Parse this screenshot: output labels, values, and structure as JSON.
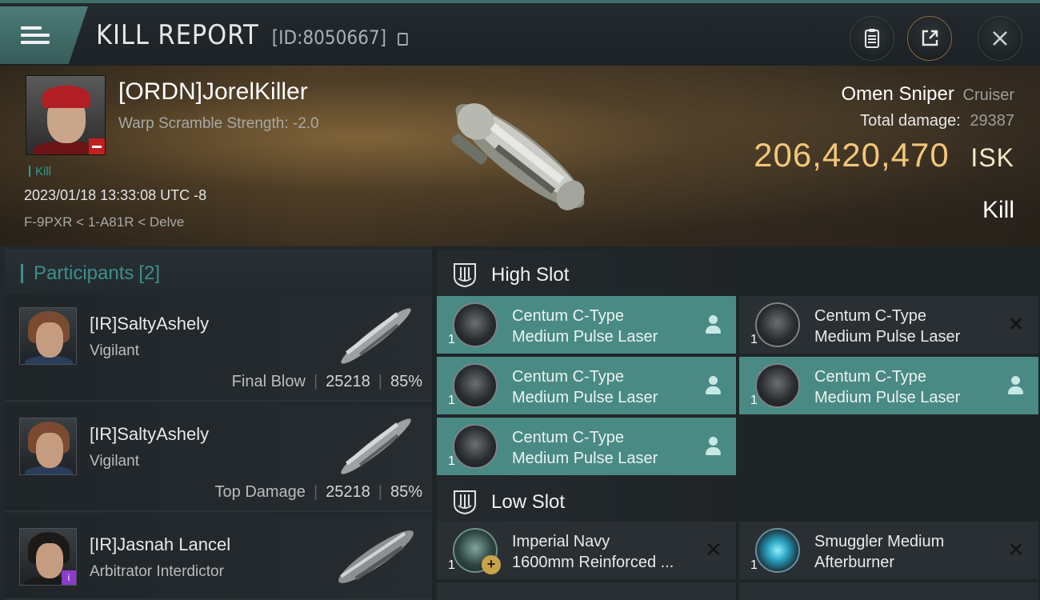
{
  "header": {
    "title": "KILL REPORT",
    "kill_id": "[ID:8050667]",
    "buttons": {
      "clipboard_icon": "clipboard-icon",
      "share_icon": "share-icon",
      "close_icon": "close-icon"
    }
  },
  "victim": {
    "name": "[ORDN]JorelKiller",
    "subtitle": "Warp Scramble Strength: -2.0",
    "tag": "Kill",
    "time": "2023/01/18 13:33:08 UTC -8",
    "location": "F-9PXR < 1-A81R < Delve",
    "ship_name": "Omen Sniper",
    "ship_class": "Cruiser",
    "total_damage_label": "Total damage:",
    "total_damage": "29387",
    "isk_value": "206,420,470",
    "isk_unit": "ISK",
    "result": "Kill"
  },
  "participants": {
    "label": "Participants",
    "count": "[2]",
    "rows": [
      {
        "name": "[IR]SaltyAshely",
        "ship": "Vigilant",
        "role": "Final Blow",
        "damage": "25218",
        "percent": "85%"
      },
      {
        "name": "[IR]SaltyAshely",
        "ship": "Vigilant",
        "role": "Top Damage",
        "damage": "25218",
        "percent": "85%"
      },
      {
        "name": "[IR]Jasnah Lancel",
        "ship": "Arbitrator Interdictor",
        "badge": "i"
      }
    ]
  },
  "fitting": {
    "high_slot_label": "High Slot",
    "low_slot_label": "Low Slot",
    "high_slots": [
      {
        "line1": "Centum C-Type",
        "line2": "Medium Pulse Laser",
        "qty": "1",
        "state": "person-icon",
        "active": true
      },
      {
        "line1": "Centum C-Type",
        "line2": "Medium Pulse Laser",
        "qty": "1",
        "state": "x-icon",
        "active": false
      },
      {
        "line1": "Centum C-Type",
        "line2": "Medium Pulse Laser",
        "qty": "1",
        "state": "person-icon",
        "active": true
      },
      {
        "line1": "Centum C-Type",
        "line2": "Medium Pulse Laser",
        "qty": "1",
        "state": "person-icon",
        "active": true
      },
      {
        "line1": "Centum C-Type",
        "line2": "Medium Pulse Laser",
        "qty": "1",
        "state": "person-icon",
        "active": true
      }
    ],
    "low_slots": [
      {
        "line1": "Imperial Navy",
        "line2": "1600mm Reinforced ...",
        "qty": "1",
        "state": "x-icon",
        "active": false
      },
      {
        "line1": "Smuggler Medium",
        "line2": "Afterburner",
        "qty": "1",
        "state": "x-icon",
        "active": false
      }
    ],
    "x_glyph": "✕"
  },
  "colors": {
    "accent_teal": "#4a8a84",
    "isk_gold": "#f3c67a",
    "tag_teal": "#2f9c92"
  }
}
